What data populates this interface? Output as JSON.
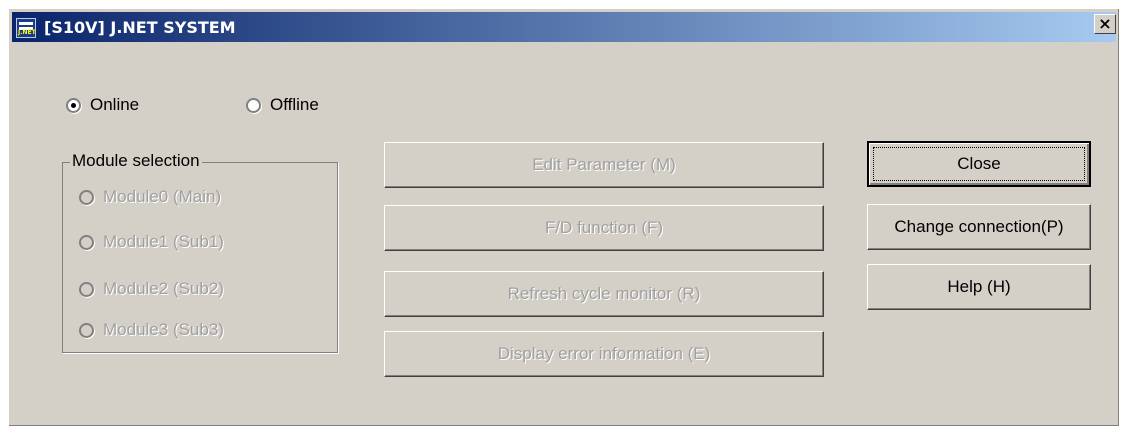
{
  "window": {
    "title": "[S10V] J.NET SYSTEM",
    "icon_text": "J.NET",
    "close_glyph": "×"
  },
  "mode": {
    "online_label": "Online",
    "offline_label": "Offline",
    "selected": "Online"
  },
  "module_selection": {
    "label": "Module selection",
    "items": [
      {
        "label": "Module0 (Main)"
      },
      {
        "label": "Module1 (Sub1)"
      },
      {
        "label": "Module2 (Sub2)"
      },
      {
        "label": "Module3 (Sub3)"
      }
    ]
  },
  "function_buttons": {
    "edit_parameter": "Edit Parameter (M)",
    "fd_function": "F/D function (F)",
    "refresh_cycle_monitor": "Refresh cycle monitor (R)",
    "display_error_information": "Display error information (E)"
  },
  "side_buttons": {
    "close": "Close",
    "change_connection": "Change connection(P)",
    "help": "Help (H)"
  }
}
